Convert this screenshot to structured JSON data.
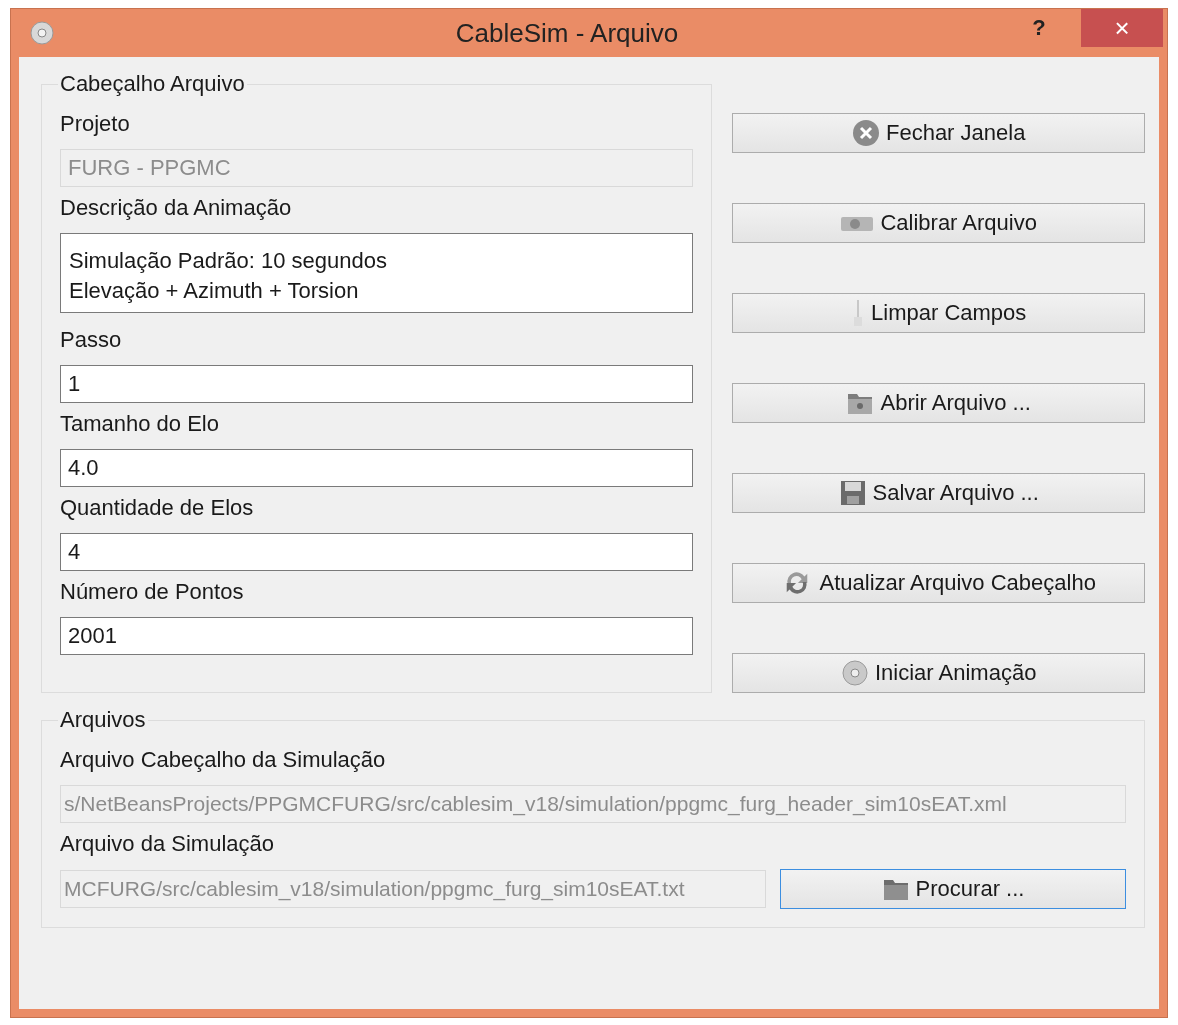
{
  "window": {
    "title": "CableSim - Arquivo",
    "help": "?",
    "close": "×"
  },
  "header_group": {
    "title": "Cabeçalho Arquivo",
    "fields": [
      {
        "label": "Projeto",
        "kind": "line",
        "value": "FURG - PPGMC",
        "disabled": true
      },
      {
        "label": "Descrição da Animação",
        "kind": "multiline",
        "lines": [
          "Simulação Padrão: 10 segundos",
          "Elevação + Azimuth + Torsion"
        ],
        "disabled": false
      },
      {
        "label": "Passo",
        "kind": "line",
        "value": "1",
        "disabled": false
      },
      {
        "label": "Tamanho do Elo",
        "kind": "line",
        "value": "4.0",
        "disabled": false
      },
      {
        "label": "Quantidade de Elos",
        "kind": "line",
        "value": "4",
        "disabled": false
      },
      {
        "label": "Número de Pontos",
        "kind": "line",
        "value": "2001",
        "disabled": false
      }
    ]
  },
  "actions": [
    {
      "label": "Fechar Janela",
      "kind": "close"
    },
    {
      "label": "Calibrar Arquivo",
      "kind": "camera"
    },
    {
      "label": "Limpar Campos",
      "kind": "brush"
    },
    {
      "label": "Abrir Arquivo ...",
      "kind": "open"
    },
    {
      "label": "Salvar Arquivo ...",
      "kind": "save"
    },
    {
      "label": "Atualizar Arquivo Cabeçalho",
      "kind": "refresh"
    },
    {
      "label": "Iniciar Animação",
      "kind": "disc"
    }
  ],
  "files_group": {
    "title": "Arquivos",
    "fields": [
      {
        "label": "Arquivo Cabeçalho da Simulação",
        "value": "s/NetBeansProjects/PPGMCFURG/src/cablesim_v18/simulation/ppgmc_furg_header_sim10sEAT.xml",
        "disabled": true
      },
      {
        "label": "Arquivo da Simulação",
        "value": "MCFURG/src/cablesim_v18/simulation/ppgmc_furg_sim10sEAT.txt",
        "disabled": true,
        "button": {
          "label": "Procurar ...",
          "kind": "folder",
          "focused": true
        }
      }
    ]
  }
}
